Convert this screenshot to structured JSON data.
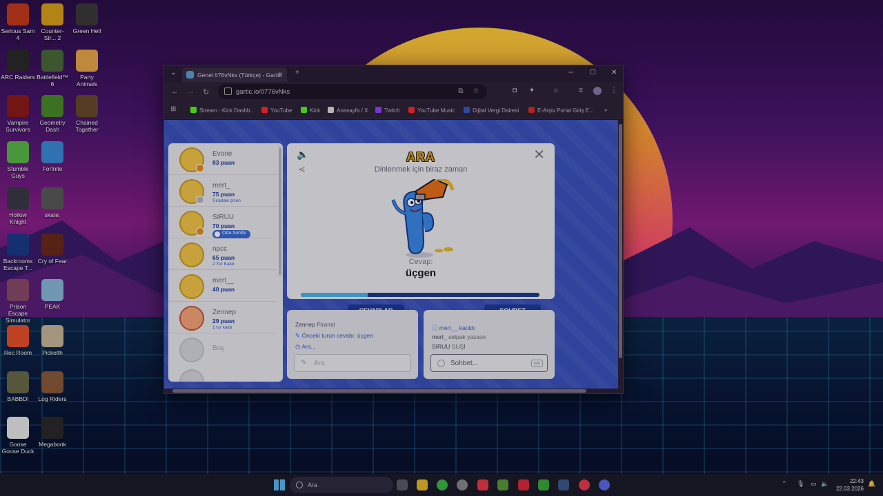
{
  "desktop": {
    "icons": [
      {
        "label": "Serious Sam 4",
        "color": "#c43a1a"
      },
      {
        "label": "Counter-Str... 2",
        "color": "#d8a21a"
      },
      {
        "label": "Green Hell",
        "color": "#3a3a3a"
      },
      {
        "label": "ARC Raiders",
        "color": "#2a2a2a"
      },
      {
        "label": "Battlefield™ 6",
        "color": "#4a6a3a"
      },
      {
        "label": "Party Animals",
        "color": "#e8a84a"
      },
      {
        "label": "Vampire Survivors",
        "color": "#8a1a1a"
      },
      {
        "label": "Geometry Dash",
        "color": "#4a8a2a"
      },
      {
        "label": "Chained Together",
        "color": "#6a4a2a"
      },
      {
        "label": "Stumble Guys",
        "color": "#5ab84a"
      },
      {
        "label": "Fortnite",
        "color": "#3a8ad8"
      },
      {
        "label": "Hollow Knight",
        "color": "#3a3a4a"
      },
      {
        "label": "skate.",
        "color": "#5a5a5a"
      },
      {
        "label": "Backrooms Escape T...",
        "color": "#1a3a8a"
      },
      {
        "label": "Cry of Fear",
        "color": "#6a2a1a"
      },
      {
        "label": "Prison Escape Simulator D...",
        "color": "#8a4a6a"
      },
      {
        "label": "PEAK",
        "color": "#8ab8d8"
      },
      {
        "label": "Rec Room",
        "color": "#e8502a"
      },
      {
        "label": "Pickelth",
        "color": "#c8b89a"
      },
      {
        "label": "BABBDI",
        "color": "#6a6a4a"
      },
      {
        "label": "Log Riders",
        "color": "#8a5a3a"
      },
      {
        "label": "Goose Goose Duck",
        "color": "#e8e8e8"
      },
      {
        "label": "Megabonk",
        "color": "#2a2a2a"
      }
    ]
  },
  "browser": {
    "tab_title": "Genel #76vNks (Türkçe) - Gartic",
    "url": "gartic.io/0776vNks",
    "bookmarks": [
      {
        "label": "Stream - Kick Dashb...",
        "color": "#53fc18"
      },
      {
        "label": "YouTube",
        "color": "#ff2a2a"
      },
      {
        "label": "Kick",
        "color": "#53fc18"
      },
      {
        "label": "Anasayfa / X",
        "color": "#dddddd"
      },
      {
        "label": "Twitch",
        "color": "#9146ff"
      },
      {
        "label": "YouTube Music",
        "color": "#ff2a2a"
      },
      {
        "label": "Dijital Vergi Dairesi",
        "color": "#3a5ad0"
      },
      {
        "label": "E-Arşiv Portal Giriş E...",
        "color": "#d82a2a"
      }
    ]
  },
  "game": {
    "players": [
      {
        "name": "Evone",
        "points": "83 puan",
        "sub": "",
        "owner": "",
        "badge": "orange"
      },
      {
        "name": "mert_",
        "points": "75 puan",
        "sub": "Sıradaki çizen",
        "owner": "",
        "badge": "gray"
      },
      {
        "name": "SIRUU",
        "points": "70 puan",
        "sub": "",
        "owner": "Oda Sahibi",
        "badge": "orange"
      },
      {
        "name": "npcc",
        "points": "65 puan",
        "sub": "2 Tur Kaldı",
        "owner": "",
        "badge": ""
      },
      {
        "name": "mert__",
        "points": "40 puan",
        "sub": "",
        "owner": "",
        "badge": ""
      },
      {
        "name": "Zennep",
        "points": "29 puan",
        "sub": "1 tur kaldı",
        "owner": "",
        "badge": ""
      }
    ],
    "empty_slot": "Boş",
    "status_title": "ARA",
    "status_sub": "Dinlenmek için biraz zaman",
    "answer_label": "Cevap:",
    "answer": "üçgen",
    "progress": 0.28,
    "tab_answers": "CEVAPLAR",
    "tab_chat": "SOHBET",
    "answers_log": [
      {
        "name": "Zennep",
        "text": "Piramit"
      },
      {
        "text": "Önceki turun cevabı: üçgen"
      },
      {
        "text": "Ara..."
      }
    ],
    "answer_placeholder": "Ara",
    "chat_log": [
      {
        "text": "mert__ katıldı"
      },
      {
        "name": "mert_",
        "text": "selpak yazsan"
      },
      {
        "name": "SIRUU",
        "text": "SUŞİ"
      }
    ],
    "chat_placeholder": "Sohbet...",
    "chat_key": "tab"
  },
  "taskbar": {
    "search": "Ara",
    "time": "22:43",
    "date": "22.03.2026"
  }
}
